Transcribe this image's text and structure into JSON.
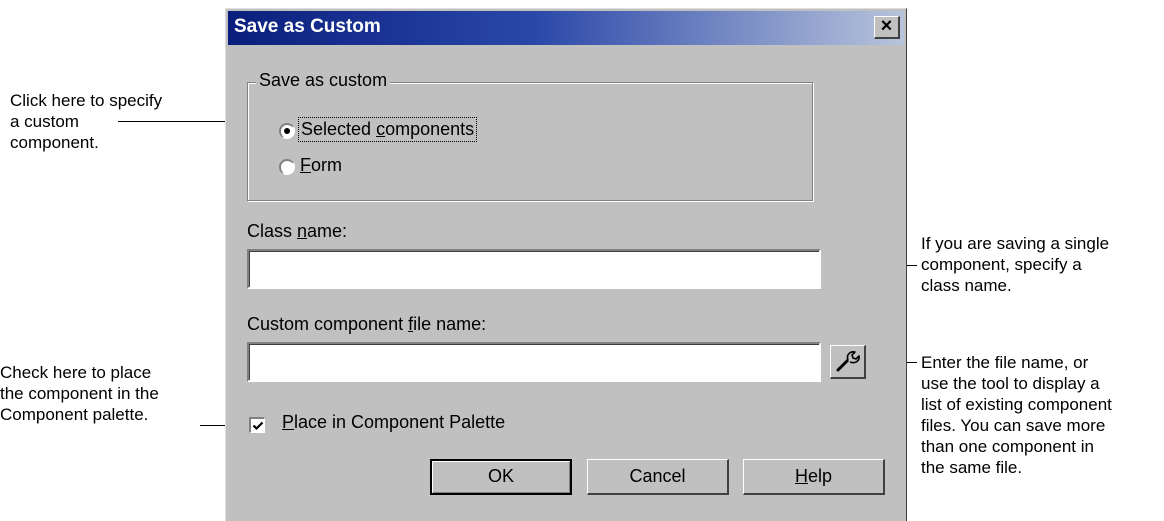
{
  "dialog": {
    "title": "Save as Custom",
    "close_label": "×",
    "group": {
      "label": "Save as custom",
      "options": [
        {
          "pre": "Selected ",
          "key": "c",
          "post": "omponents",
          "selected": true
        },
        {
          "pre": "",
          "key": "F",
          "post": "orm",
          "selected": false
        }
      ]
    },
    "class_name": {
      "pre": "Class ",
      "key": "n",
      "post": "ame:",
      "value": ""
    },
    "file_name": {
      "pre": "Custom component ",
      "key": "f",
      "post": "ile name:",
      "value": ""
    },
    "palette_checkbox": {
      "pre": "",
      "key": "P",
      "post": "lace in Component Palette",
      "checked": true
    },
    "buttons": {
      "ok": "OK",
      "cancel": "Cancel",
      "help": {
        "pre": "",
        "key": "H",
        "post": "elp"
      }
    }
  },
  "callouts": {
    "custom_component": "Click here to specify\na custom\ncomponent.",
    "class_name": "If you are saving a single\ncomponent, specify a\nclass name.",
    "palette": "Check here to place\nthe component in the\nComponent palette.",
    "file_name": "Enter the file name, or\nuse the tool to display a\nlist of existing component\nfiles. You can save more\nthan one component in\nthe same file."
  }
}
